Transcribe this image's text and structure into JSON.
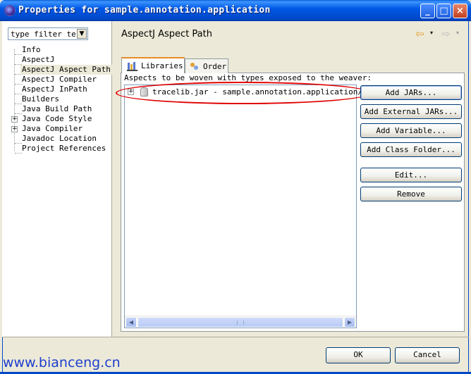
{
  "window": {
    "title": "Properties for sample.annotation.application",
    "min_glyph": "_",
    "max_glyph": "□",
    "close_glyph": "×"
  },
  "filter": {
    "value": "type filter tex",
    "drop_glyph": "▼"
  },
  "tree": {
    "items": [
      {
        "label": "Info",
        "selected": false,
        "expandable": false
      },
      {
        "label": "AspectJ",
        "selected": false,
        "expandable": false
      },
      {
        "label": "AspectJ Aspect Path",
        "selected": true,
        "expandable": false
      },
      {
        "label": "AspectJ Compiler",
        "selected": false,
        "expandable": false
      },
      {
        "label": "AspectJ InPath",
        "selected": false,
        "expandable": false
      },
      {
        "label": "Builders",
        "selected": false,
        "expandable": false
      },
      {
        "label": "Java Build Path",
        "selected": false,
        "expandable": false
      },
      {
        "label": "Java Code Style",
        "selected": false,
        "expandable": true
      },
      {
        "label": "Java Compiler",
        "selected": false,
        "expandable": true
      },
      {
        "label": "Javadoc Location",
        "selected": false,
        "expandable": false
      },
      {
        "label": "Project References",
        "selected": false,
        "expandable": false
      }
    ],
    "expander_glyph": "+"
  },
  "page": {
    "title": "AspectJ Aspect Path"
  },
  "nav": {
    "back_glyph": "⇦",
    "forward_glyph": "⇨",
    "drop_glyph": "▾"
  },
  "tabs": [
    {
      "label": "Libraries",
      "active": true
    },
    {
      "label": "Order",
      "active": false
    }
  ],
  "libraries": {
    "description": "Aspects to be woven with types exposed to the weaver:",
    "entries": [
      {
        "text": "tracelib.jar - sample.annotation.application/lib"
      }
    ],
    "expander_glyph": "+"
  },
  "buttons": {
    "add_jars": "Add JARs...",
    "add_external_jars": "Add External JARs...",
    "add_variable": "Add Variable...",
    "add_class_folder": "Add Class Folder...",
    "edit": "Edit...",
    "remove": "Remove"
  },
  "dialog": {
    "ok": "OK",
    "cancel": "Cancel"
  },
  "scrollbar": {
    "left_glyph": "◀",
    "right_glyph": "▶"
  },
  "watermark": "www.bianceng.cn",
  "colors": {
    "highlight": "#E00000",
    "titlebar": "#0058E6",
    "selection": "#ECE9D8"
  }
}
